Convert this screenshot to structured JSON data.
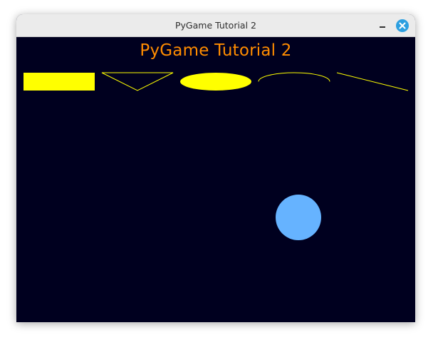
{
  "window": {
    "title": "PyGame Tutorial 2"
  },
  "titlebar_buttons": {
    "minimize_icon": "minimize-icon",
    "close_icon": "close-icon"
  },
  "game": {
    "heading": "PyGame Tutorial 2",
    "colors": {
      "background": "#00001f",
      "heading": "#ff8c00",
      "shapes": "#ffff00",
      "ball": "#66b3ff"
    },
    "shapes": [
      "filled-rectangle",
      "outlined-triangle",
      "filled-ellipse",
      "arc",
      "line",
      "filled-circle"
    ]
  }
}
